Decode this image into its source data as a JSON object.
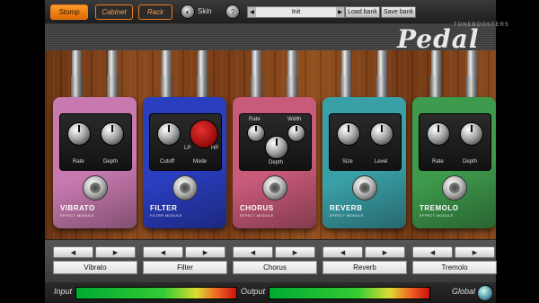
{
  "toolbar": {
    "modes": [
      {
        "label": "Stomp",
        "active": true
      },
      {
        "label": "Cabinet",
        "active": false
      },
      {
        "label": "Rack",
        "active": false
      }
    ],
    "skin_label": "Skin",
    "preset_name": "Init",
    "load_bank_label": "Load bank",
    "save_bank_label": "Save bank"
  },
  "header": {
    "brand_small": "TONEBOOSTERS",
    "brand": "Pedal"
  },
  "pedals": [
    {
      "name": "VIBRATO",
      "sub": "EFFECT MODULE",
      "color": "#c87ab0",
      "knobs": [
        "Rate",
        "Depth"
      ]
    },
    {
      "name": "FILTER",
      "sub": "FILTER MODULE",
      "color": "#2a3ec0",
      "knobs": [
        "Cutoff",
        "Mode"
      ],
      "switch_labels": [
        "LP",
        "HP"
      ]
    },
    {
      "name": "CHORUS",
      "sub": "EFFECT MODULE",
      "color": "#c85a7a",
      "knobs": [
        "Rate",
        "Width",
        "Depth"
      ]
    },
    {
      "name": "REVERB",
      "sub": "EFFECT MODULE",
      "color": "#3aa0a8",
      "knobs": [
        "Size",
        "Level"
      ]
    },
    {
      "name": "TREMOLO",
      "sub": "EFFECT MODULE",
      "color": "#3e9a4c",
      "knobs": [
        "Rate",
        "Depth"
      ]
    }
  ],
  "selectors": [
    "Vibrato",
    "Filter",
    "Chorus",
    "Reverb",
    "Tremolo"
  ],
  "io": {
    "input_label": "Input",
    "output_label": "Output",
    "global_label": "Global"
  }
}
